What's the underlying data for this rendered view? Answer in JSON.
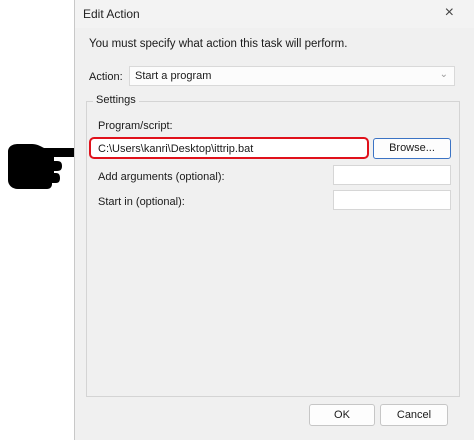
{
  "window": {
    "title": "Edit Action",
    "close_glyph": "×"
  },
  "instruction": "You must specify what action this task will perform.",
  "action": {
    "label": "Action:",
    "selected": "Start a program",
    "options_icon": "chevron-down-icon"
  },
  "settings": {
    "legend": "Settings",
    "program_label": "Program/script:",
    "program_value": "C:\\Users\\kanri\\Desktop\\ittrip.bat",
    "browse_label": "Browse...",
    "arguments_label": "Add arguments (optional):",
    "arguments_value": "",
    "start_in_label": "Start in (optional):",
    "start_in_value": ""
  },
  "buttons": {
    "ok": "OK",
    "cancel": "Cancel"
  },
  "annotation": {
    "pointer_icon": "pointing-hand-icon",
    "highlight_color": "#e0111b"
  }
}
